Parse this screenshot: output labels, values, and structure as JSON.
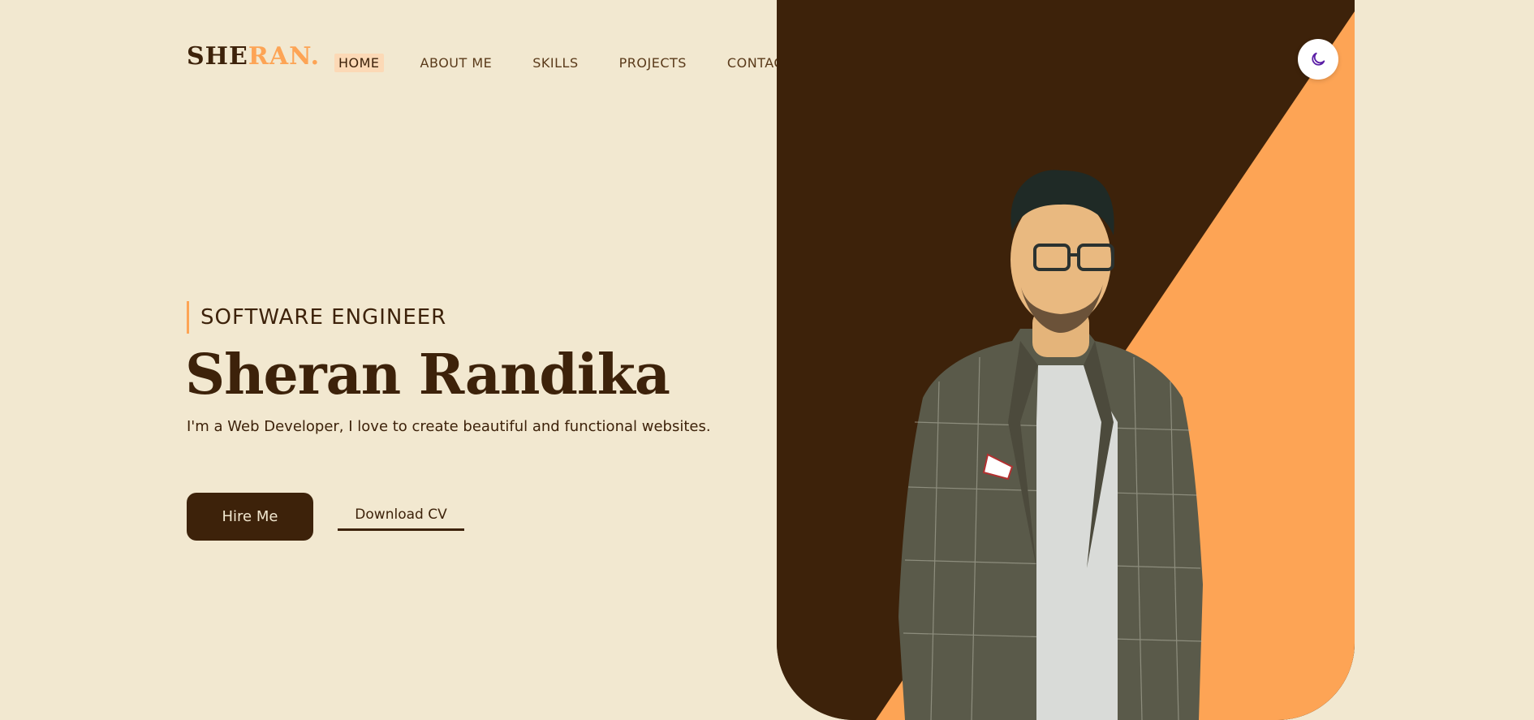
{
  "header": {
    "logo": {
      "part1": "SHE",
      "part2": "RAN."
    },
    "nav": [
      {
        "label": "HOME",
        "active": true
      },
      {
        "label": "ABOUT ME",
        "active": false
      },
      {
        "label": "SKILLS",
        "active": false
      },
      {
        "label": "PROJECTS",
        "active": false
      },
      {
        "label": "CONTACT ME",
        "active": false
      }
    ],
    "theme_toggle_icon": "moon-icon"
  },
  "hero": {
    "subtitle": "SOFTWARE ENGINEER",
    "name": "Sheran Randika",
    "tagline": "I'm a Web Developer, I love to create beautiful and functional websites.",
    "hire_label": "Hire Me",
    "download_label": "Download CV",
    "portrait_icon": "profile-photo"
  },
  "colors": {
    "background": "#f2e8d0",
    "dark_brown": "#3d220a",
    "accent_orange": "#fda455",
    "active_nav_bg": "#fcd9b6",
    "moon_icon": "#5b1fa6"
  }
}
